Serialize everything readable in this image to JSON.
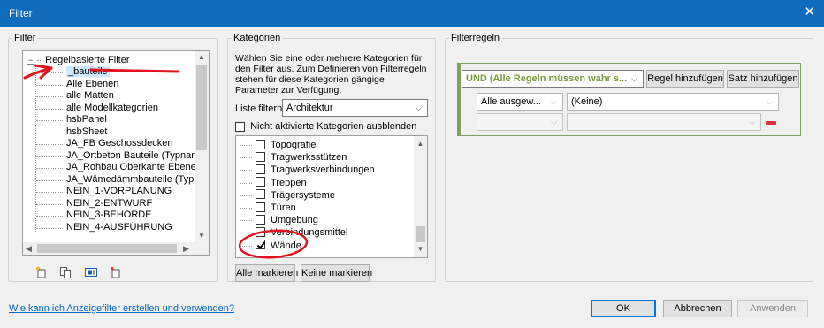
{
  "window": {
    "title": "Filter"
  },
  "filter_panel": {
    "legend": "Filter",
    "root_label": "Regelbasierte Filter",
    "items": [
      "_bauteile",
      "Alle Ebenen",
      "alle Matten",
      "alle Modellkategorien",
      "hsbPanel",
      "hsbSheet",
      "JA_FB Geschossdecken",
      "JA_Ortbeton Bauteile (Typname)",
      "JA_Rohbau Oberkante Ebenen",
      "JA_Wämedämmbauteile (Typna...",
      "NEIN_1-VORPLANUNG",
      "NEIN_2-ENTWURF",
      "NEIN_3-BEHÖRDE",
      "NEIN_4-AUSFÜHRUNG"
    ],
    "selected_index": 0,
    "tools": [
      "new-filter-icon",
      "duplicate-icon",
      "rename-icon",
      "delete-icon"
    ]
  },
  "categories_panel": {
    "legend": "Kategorien",
    "description": "Wählen Sie eine oder mehrere Kategorien für den Filter aus. Zum Definieren von Filterregeln stehen für diese Kategorien gängige Parameter zur Verfügung.",
    "list_filter_label": "Liste filtern:",
    "list_filter_value": "Architektur",
    "hide_inactive_label": "Nicht aktivierte Kategorien ausblenden",
    "items": [
      {
        "label": "Topografie",
        "checked": false
      },
      {
        "label": "Tragwerksstützen",
        "checked": false
      },
      {
        "label": "Tragwerksverbindungen",
        "checked": false
      },
      {
        "label": "Treppen",
        "checked": false
      },
      {
        "label": "Trägersysteme",
        "checked": false
      },
      {
        "label": "Türen",
        "checked": false
      },
      {
        "label": "Umgebung",
        "checked": false
      },
      {
        "label": "Verbindungsmittel",
        "checked": false
      },
      {
        "label": "Wände",
        "checked": true
      }
    ],
    "check_all": "Alle markieren",
    "check_none": "Keine markieren"
  },
  "rules_panel": {
    "legend": "Filterregeln",
    "logic": "UND (Alle Regeln müssen wahr s...",
    "add_rule": "Regel hinzufügen",
    "add_set": "Satz hinzufügen",
    "row1": {
      "param": "Alle ausgew...",
      "value": "(Keine)"
    },
    "row2": {
      "param": "",
      "value": ""
    }
  },
  "footer": {
    "help": "Wie kann ich Anzeigefilter erstellen und verwenden?",
    "ok": "OK",
    "cancel": "Abbrechen",
    "apply": "Anwenden"
  },
  "colors": {
    "titlebar": "#0f6cbd",
    "accent_green": "#7ea35a",
    "annotation_red": "#e0141e"
  }
}
